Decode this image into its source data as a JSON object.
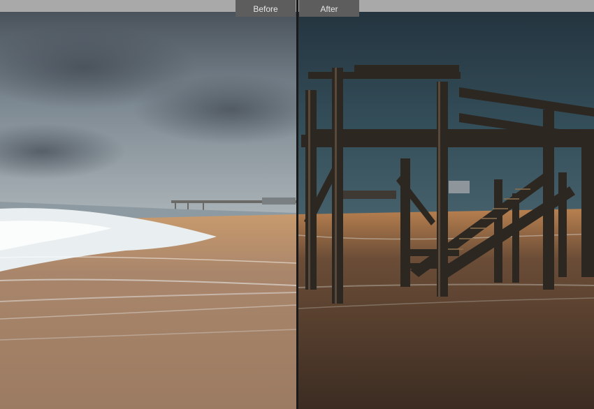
{
  "view": {
    "before_label": "Before",
    "after_label": "After"
  },
  "colors": {
    "toolbar_bg": "#a9a9a9",
    "tab_bg": "#5d5d5d",
    "tab_text": "#e6e6e6",
    "divider": "#1a1a1a"
  }
}
